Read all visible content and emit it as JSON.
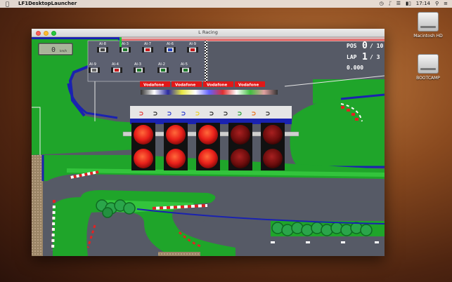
{
  "menubar": {
    "app_name": "LF1DesktopLauncher",
    "time": "17:14"
  },
  "desktop": {
    "icons": [
      {
        "label": "Macintosh HD"
      },
      {
        "label": "BOOTCAMP"
      }
    ]
  },
  "window": {
    "title": "L Racing"
  },
  "hud": {
    "speed_value": "0",
    "speed_unit": "km/h",
    "pos_label": "POS",
    "pos_value": "0",
    "pos_total": "/ 10",
    "lap_label": "LAP",
    "lap_value": "1",
    "lap_total": "/ 3",
    "time": "0.000"
  },
  "grid_cars_row1": [
    "AI-8",
    "AI-3",
    "AI-7",
    "AI-6",
    "AI-9"
  ],
  "grid_cars_row2": [
    "AI-9",
    "AI-4",
    "AI-3",
    "AI-2",
    "AI-5"
  ],
  "banners": [
    "Vodafone",
    "Vodafone",
    "Vodafone",
    "Vodafone",
    "Vodafone"
  ],
  "start_lights": {
    "count": 5,
    "lit": 3,
    "lit_color": "#e8201a",
    "off_color": "#7a0d0d"
  },
  "colors": {
    "track": "#565a66",
    "grass": "#1fa52a",
    "grass_light": "#33c43c",
    "kerb_red": "#e32222",
    "kerb_white": "#ffffff",
    "barrier_blue": "#1a22b0"
  }
}
